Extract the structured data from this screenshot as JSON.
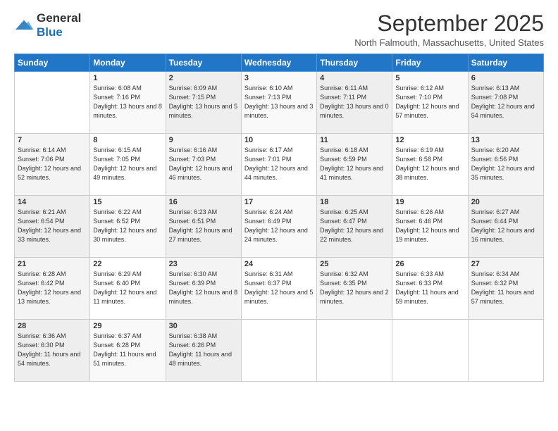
{
  "header": {
    "logo_general": "General",
    "logo_blue": "Blue",
    "month_title": "September 2025",
    "location": "North Falmouth, Massachusetts, United States"
  },
  "weekdays": [
    "Sunday",
    "Monday",
    "Tuesday",
    "Wednesday",
    "Thursday",
    "Friday",
    "Saturday"
  ],
  "weeks": [
    [
      {
        "day": "",
        "sunrise": "",
        "sunset": "",
        "daylight": ""
      },
      {
        "day": "1",
        "sunrise": "Sunrise: 6:08 AM",
        "sunset": "Sunset: 7:16 PM",
        "daylight": "Daylight: 13 hours and 8 minutes."
      },
      {
        "day": "2",
        "sunrise": "Sunrise: 6:09 AM",
        "sunset": "Sunset: 7:15 PM",
        "daylight": "Daylight: 13 hours and 5 minutes."
      },
      {
        "day": "3",
        "sunrise": "Sunrise: 6:10 AM",
        "sunset": "Sunset: 7:13 PM",
        "daylight": "Daylight: 13 hours and 3 minutes."
      },
      {
        "day": "4",
        "sunrise": "Sunrise: 6:11 AM",
        "sunset": "Sunset: 7:11 PM",
        "daylight": "Daylight: 13 hours and 0 minutes."
      },
      {
        "day": "5",
        "sunrise": "Sunrise: 6:12 AM",
        "sunset": "Sunset: 7:10 PM",
        "daylight": "Daylight: 12 hours and 57 minutes."
      },
      {
        "day": "6",
        "sunrise": "Sunrise: 6:13 AM",
        "sunset": "Sunset: 7:08 PM",
        "daylight": "Daylight: 12 hours and 54 minutes."
      }
    ],
    [
      {
        "day": "7",
        "sunrise": "Sunrise: 6:14 AM",
        "sunset": "Sunset: 7:06 PM",
        "daylight": "Daylight: 12 hours and 52 minutes."
      },
      {
        "day": "8",
        "sunrise": "Sunrise: 6:15 AM",
        "sunset": "Sunset: 7:05 PM",
        "daylight": "Daylight: 12 hours and 49 minutes."
      },
      {
        "day": "9",
        "sunrise": "Sunrise: 6:16 AM",
        "sunset": "Sunset: 7:03 PM",
        "daylight": "Daylight: 12 hours and 46 minutes."
      },
      {
        "day": "10",
        "sunrise": "Sunrise: 6:17 AM",
        "sunset": "Sunset: 7:01 PM",
        "daylight": "Daylight: 12 hours and 44 minutes."
      },
      {
        "day": "11",
        "sunrise": "Sunrise: 6:18 AM",
        "sunset": "Sunset: 6:59 PM",
        "daylight": "Daylight: 12 hours and 41 minutes."
      },
      {
        "day": "12",
        "sunrise": "Sunrise: 6:19 AM",
        "sunset": "Sunset: 6:58 PM",
        "daylight": "Daylight: 12 hours and 38 minutes."
      },
      {
        "day": "13",
        "sunrise": "Sunrise: 6:20 AM",
        "sunset": "Sunset: 6:56 PM",
        "daylight": "Daylight: 12 hours and 35 minutes."
      }
    ],
    [
      {
        "day": "14",
        "sunrise": "Sunrise: 6:21 AM",
        "sunset": "Sunset: 6:54 PM",
        "daylight": "Daylight: 12 hours and 33 minutes."
      },
      {
        "day": "15",
        "sunrise": "Sunrise: 6:22 AM",
        "sunset": "Sunset: 6:52 PM",
        "daylight": "Daylight: 12 hours and 30 minutes."
      },
      {
        "day": "16",
        "sunrise": "Sunrise: 6:23 AM",
        "sunset": "Sunset: 6:51 PM",
        "daylight": "Daylight: 12 hours and 27 minutes."
      },
      {
        "day": "17",
        "sunrise": "Sunrise: 6:24 AM",
        "sunset": "Sunset: 6:49 PM",
        "daylight": "Daylight: 12 hours and 24 minutes."
      },
      {
        "day": "18",
        "sunrise": "Sunrise: 6:25 AM",
        "sunset": "Sunset: 6:47 PM",
        "daylight": "Daylight: 12 hours and 22 minutes."
      },
      {
        "day": "19",
        "sunrise": "Sunrise: 6:26 AM",
        "sunset": "Sunset: 6:46 PM",
        "daylight": "Daylight: 12 hours and 19 minutes."
      },
      {
        "day": "20",
        "sunrise": "Sunrise: 6:27 AM",
        "sunset": "Sunset: 6:44 PM",
        "daylight": "Daylight: 12 hours and 16 minutes."
      }
    ],
    [
      {
        "day": "21",
        "sunrise": "Sunrise: 6:28 AM",
        "sunset": "Sunset: 6:42 PM",
        "daylight": "Daylight: 12 hours and 13 minutes."
      },
      {
        "day": "22",
        "sunrise": "Sunrise: 6:29 AM",
        "sunset": "Sunset: 6:40 PM",
        "daylight": "Daylight: 12 hours and 11 minutes."
      },
      {
        "day": "23",
        "sunrise": "Sunrise: 6:30 AM",
        "sunset": "Sunset: 6:39 PM",
        "daylight": "Daylight: 12 hours and 8 minutes."
      },
      {
        "day": "24",
        "sunrise": "Sunrise: 6:31 AM",
        "sunset": "Sunset: 6:37 PM",
        "daylight": "Daylight: 12 hours and 5 minutes."
      },
      {
        "day": "25",
        "sunrise": "Sunrise: 6:32 AM",
        "sunset": "Sunset: 6:35 PM",
        "daylight": "Daylight: 12 hours and 2 minutes."
      },
      {
        "day": "26",
        "sunrise": "Sunrise: 6:33 AM",
        "sunset": "Sunset: 6:33 PM",
        "daylight": "Daylight: 11 hours and 59 minutes."
      },
      {
        "day": "27",
        "sunrise": "Sunrise: 6:34 AM",
        "sunset": "Sunset: 6:32 PM",
        "daylight": "Daylight: 11 hours and 57 minutes."
      }
    ],
    [
      {
        "day": "28",
        "sunrise": "Sunrise: 6:36 AM",
        "sunset": "Sunset: 6:30 PM",
        "daylight": "Daylight: 11 hours and 54 minutes."
      },
      {
        "day": "29",
        "sunrise": "Sunrise: 6:37 AM",
        "sunset": "Sunset: 6:28 PM",
        "daylight": "Daylight: 11 hours and 51 minutes."
      },
      {
        "day": "30",
        "sunrise": "Sunrise: 6:38 AM",
        "sunset": "Sunset: 6:26 PM",
        "daylight": "Daylight: 11 hours and 48 minutes."
      },
      {
        "day": "",
        "sunrise": "",
        "sunset": "",
        "daylight": ""
      },
      {
        "day": "",
        "sunrise": "",
        "sunset": "",
        "daylight": ""
      },
      {
        "day": "",
        "sunrise": "",
        "sunset": "",
        "daylight": ""
      },
      {
        "day": "",
        "sunrise": "",
        "sunset": "",
        "daylight": ""
      }
    ]
  ]
}
